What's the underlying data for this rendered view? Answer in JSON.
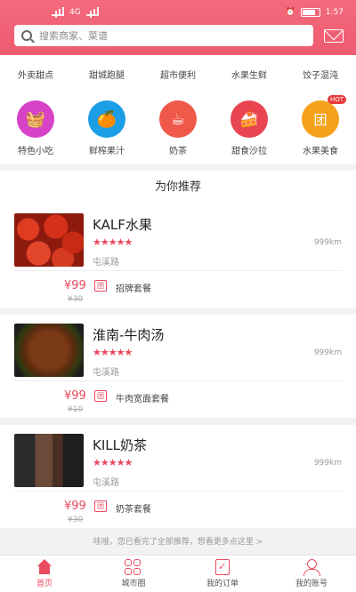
{
  "status": {
    "signal_text": "4G",
    "battery": "1:57"
  },
  "search": {
    "placeholder": "搜索商家、菜谱"
  },
  "categories_row1": [
    "外卖甜点",
    "甜城跑腿",
    "超市便利",
    "水果生鲜",
    "饺子混沌"
  ],
  "categories_row2": [
    {
      "label": "特色小吃",
      "icon": "basket-icon",
      "color": "#d743c6",
      "glyph": "🧺"
    },
    {
      "label": "鲜榨果汁",
      "icon": "orange-icon",
      "color": "#1c9ee6",
      "glyph": "🍊"
    },
    {
      "label": "奶茶",
      "icon": "coffee-icon",
      "color": "#f0584a",
      "glyph": "☕"
    },
    {
      "label": "甜食沙拉",
      "icon": "cake-icon",
      "color": "#e84550",
      "glyph": "🍰"
    },
    {
      "label": "水果美食",
      "icon": "tuan-icon",
      "color": "#f5a21a",
      "glyph": "团",
      "badge": "HOT"
    }
  ],
  "recommend_title": "为你推荐",
  "items": [
    {
      "name": "KALF水果",
      "stars": "★★★★★",
      "distance": "999km",
      "area": "屯溪路",
      "price": "¥99",
      "old_price": "¥30",
      "tuan": "团",
      "deal": "招牌套餐"
    },
    {
      "name": "淮南-牛肉汤",
      "stars": "★★★★★",
      "distance": "999km",
      "area": "屯溪路",
      "price": "¥99",
      "old_price": "¥10",
      "tuan": "团",
      "deal": "牛肉宽面套餐"
    },
    {
      "name": "KILL奶茶",
      "stars": "★★★★★",
      "distance": "999km",
      "area": "屯溪路",
      "price": "¥99",
      "old_price": "¥30",
      "tuan": "团",
      "deal": "奶茶套餐"
    }
  ],
  "more_text": "哇哦，您已看完了全部推荐，想看更多点这里 >",
  "tabs": [
    "首页",
    "城市圈",
    "我的订单",
    "我的账号"
  ]
}
